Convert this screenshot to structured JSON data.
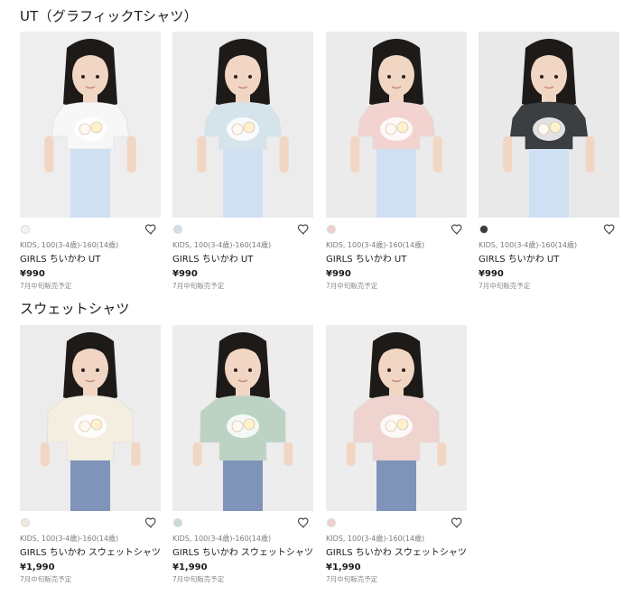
{
  "sections": [
    {
      "title": "UT（グラフィックTシャツ）",
      "products": [
        {
          "size": "KIDS, 100(3-4歳)-160(14歳)",
          "name": "GIRLS ちいかわ UT",
          "price": "¥990",
          "note": "7月中旬販売予定",
          "swatch": "#f3f3f3",
          "shirt": "#f7f7f7",
          "bg": "#eeeeee",
          "icon": "heart-icon"
        },
        {
          "size": "KIDS, 100(3-4歳)-160(14歳)",
          "name": "GIRLS ちいかわ UT",
          "price": "¥990",
          "note": "7月中旬販売予定",
          "swatch": "#cfe0e8",
          "shirt": "#d4e4ea",
          "bg": "#ececec",
          "icon": "heart-icon"
        },
        {
          "size": "KIDS, 100(3-4歳)-160(14歳)",
          "name": "GIRLS ちいかわ UT",
          "price": "¥990",
          "note": "7月中旬販売予定",
          "swatch": "#f0cfcf",
          "shirt": "#f3d3d0",
          "bg": "#ebebeb",
          "icon": "heart-icon"
        },
        {
          "size": "KIDS, 100(3-4歳)-160(14歳)",
          "name": "GIRLS ちいかわ UT",
          "price": "¥990",
          "note": "7月中旬販売予定",
          "swatch": "#3a3d40",
          "shirt": "#3c3f42",
          "bg": "#e9e9e9",
          "icon": "heart-icon"
        }
      ]
    },
    {
      "title": "スウェットシャツ",
      "products": [
        {
          "size": "KIDS, 100(3-4歳)-160(14歳)",
          "name": "GIRLS ちいかわ スウェットシャツ",
          "price": "¥1,990",
          "note": "7月中旬販売予定",
          "swatch": "#efeadd",
          "shirt": "#f3eee0",
          "bg": "#ececec",
          "icon": "heart-icon"
        },
        {
          "size": "KIDS, 100(3-4歳)-160(14歳)",
          "name": "GIRLS ちいかわ スウェットシャツ",
          "price": "¥1,990",
          "note": "7月中旬販売予定",
          "swatch": "#c7dccf",
          "shirt": "#bcd3c4",
          "bg": "#ededed",
          "icon": "heart-icon"
        },
        {
          "size": "KIDS, 100(3-4歳)-160(14歳)",
          "name": "GIRLS ちいかわ スウェットシャツ",
          "price": "¥1,990",
          "note": "7月中旬販売予定",
          "swatch": "#eed0cc",
          "shirt": "#efd3ce",
          "bg": "#ededed",
          "icon": "heart-icon"
        }
      ]
    }
  ]
}
